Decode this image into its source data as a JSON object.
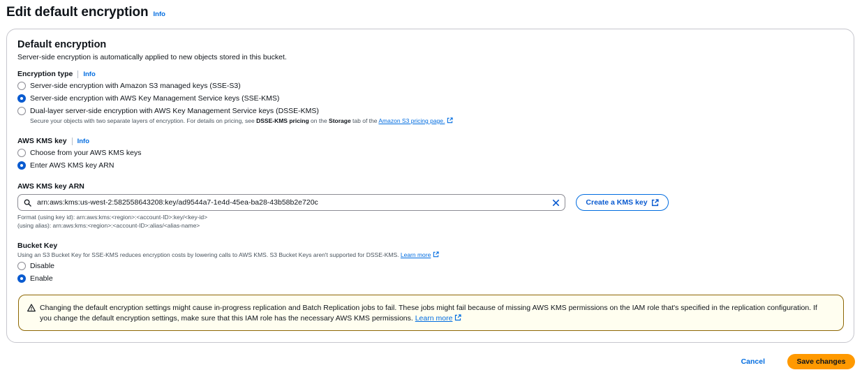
{
  "header": {
    "title": "Edit default encryption",
    "info_label": "Info"
  },
  "default_encryption": {
    "title": "Default encryption",
    "description": "Server-side encryption is automatically applied to new objects stored in this bucket.",
    "encryption_type": {
      "label": "Encryption type",
      "info_label": "Info",
      "options": [
        {
          "label": "Server-side encryption with Amazon S3 managed keys (SSE-S3)",
          "checked": false
        },
        {
          "label": "Server-side encryption with AWS Key Management Service keys (SSE-KMS)",
          "checked": true
        },
        {
          "label": "Dual-layer server-side encryption with AWS Key Management Service keys (DSSE-KMS)",
          "checked": false
        }
      ],
      "hint_prefix": "Secure your objects with two separate layers of encryption. For details on pricing, see ",
      "hint_bold_1": "DSSE-KMS pricing",
      "hint_mid": " on the ",
      "hint_bold_2": "Storage",
      "hint_suffix": " tab of the ",
      "hint_link": "Amazon S3 pricing page."
    },
    "kms_key": {
      "label": "AWS KMS key",
      "info_label": "Info",
      "options": [
        {
          "label": "Choose from your AWS KMS keys",
          "checked": false
        },
        {
          "label": "Enter AWS KMS key ARN",
          "checked": true
        }
      ]
    },
    "kms_key_arn": {
      "label": "AWS KMS key ARN",
      "value": "arn:aws:kms:us-west-2:582558643208:key/ad9544a7-1e4d-45ea-ba28-43b58b2e720c",
      "create_button": "Create a KMS key",
      "format_key_id": "Format (using key id): arn:aws:kms:<region>:<account-ID>:key/<key-id>",
      "format_alias": "(using alias): arn:aws:kms:<region>:<account-ID>:alias/<alias-name>"
    },
    "bucket_key": {
      "label": "Bucket Key",
      "hint": "Using an S3 Bucket Key for SSE-KMS reduces encryption costs by lowering calls to AWS KMS. S3 Bucket Keys aren't supported for DSSE-KMS. ",
      "hint_link": "Learn more",
      "options": [
        {
          "label": "Disable",
          "checked": false
        },
        {
          "label": "Enable",
          "checked": true
        }
      ]
    },
    "alert": {
      "text": "Changing the default encryption settings might cause in-progress replication and Batch Replication jobs to fail. These jobs might fail because of missing AWS KMS permissions on the IAM role that's specified in the replication configuration. If you change the default encryption settings, make sure that this IAM role has the necessary AWS KMS permissions. ",
      "link": "Learn more"
    }
  },
  "footer": {
    "cancel_label": "Cancel",
    "save_label": "Save changes"
  },
  "colors": {
    "primary_blue": "#006ce0",
    "save_orange": "#ff9900",
    "warning_border": "#8d6605",
    "warning_bg": "#fffef0"
  }
}
